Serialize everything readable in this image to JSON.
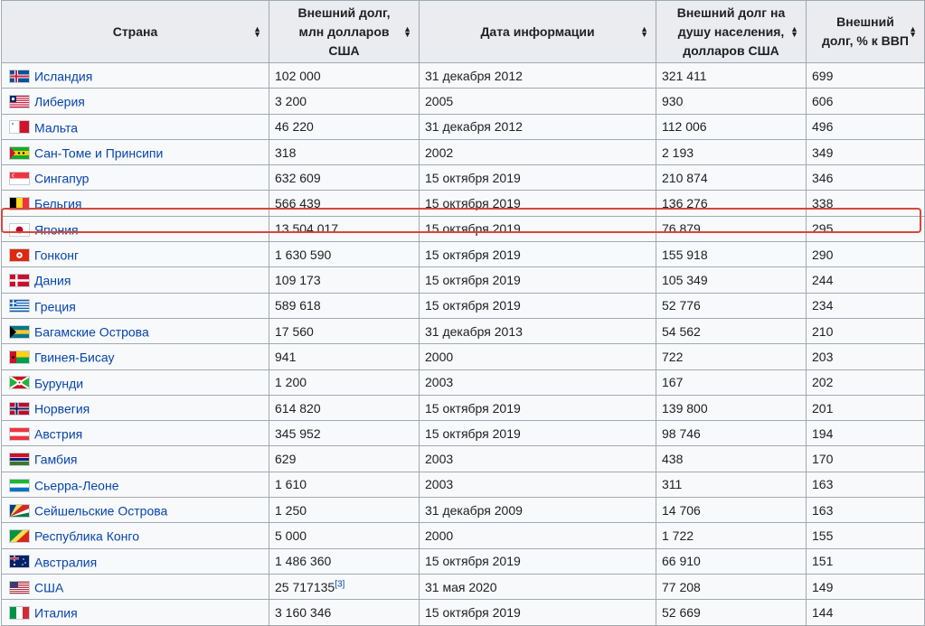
{
  "headers": [
    {
      "label": "Страна"
    },
    {
      "label": "Внешний долг, млн долларов США"
    },
    {
      "label": "Дата информации"
    },
    {
      "label": "Внешний долг на душу населения, долларов США"
    },
    {
      "label": "Внешний долг, % к ВВП"
    }
  ],
  "sort_icon": "sort-arrows-icon",
  "highlight_color": "#d9453c",
  "rows": [
    {
      "country": "Исландия",
      "flag": "iceland",
      "debt": "102 000",
      "date": "31 декабря 2012",
      "per_capita": "321 411",
      "gdp": "699"
    },
    {
      "country": "Либерия",
      "flag": "liberia",
      "debt": "3 200",
      "date": "2005",
      "per_capita": "930",
      "gdp": "606"
    },
    {
      "country": "Мальта",
      "flag": "malta",
      "debt": "46 220",
      "date": "31 декабря 2012",
      "per_capita": "112 006",
      "gdp": "496"
    },
    {
      "country": "Сан-Томе и Принсипи",
      "flag": "sao-tome",
      "debt": "318",
      "date": "2002",
      "per_capita": "2 193",
      "gdp": "349"
    },
    {
      "country": "Сингапур",
      "flag": "singapore",
      "debt": "632 609",
      "date": "15 октября 2019",
      "per_capita": "210 874",
      "gdp": "346"
    },
    {
      "country": "Бельгия",
      "flag": "belgium",
      "debt": "566 439",
      "date": "15 октября 2019",
      "per_capita": "136 276",
      "gdp": "338"
    },
    {
      "country": "Япония",
      "flag": "japan",
      "debt": "13 504 017",
      "date": "15 октября 2019",
      "per_capita": "76 879",
      "gdp": "295"
    },
    {
      "country": "Гонконг",
      "flag": "hongkong",
      "debt": "1 630 590",
      "date": "15 октября 2019",
      "per_capita": "155 918",
      "gdp": "290"
    },
    {
      "country": "Дания",
      "flag": "denmark",
      "debt": "109 173",
      "date": "15 октября 2019",
      "per_capita": "105 349",
      "gdp": "244"
    },
    {
      "country": "Греция",
      "flag": "greece",
      "debt": "589 618",
      "date": "15 октября 2019",
      "per_capita": "52 776",
      "gdp": "234"
    },
    {
      "country": "Багамские Острова",
      "flag": "bahamas",
      "debt": "17 560",
      "date": "31 декабря 2013",
      "per_capita": "54 562",
      "gdp": "210"
    },
    {
      "country": "Гвинея-Бисау",
      "flag": "guinea-bissau",
      "debt": "941",
      "date": "2000",
      "per_capita": "722",
      "gdp": "203"
    },
    {
      "country": "Бурунди",
      "flag": "burundi",
      "debt": "1 200",
      "date": "2003",
      "per_capita": "167",
      "gdp": "202"
    },
    {
      "country": "Норвегия",
      "flag": "norway",
      "debt": "614 820",
      "date": "15 октября 2019",
      "per_capita": "139 800",
      "gdp": "201"
    },
    {
      "country": "Австрия",
      "flag": "austria",
      "debt": "345 952",
      "date": "15 октября 2019",
      "per_capita": "98 746",
      "gdp": "194"
    },
    {
      "country": "Гамбия",
      "flag": "gambia",
      "debt": "629",
      "date": "2003",
      "per_capita": "438",
      "gdp": "170"
    },
    {
      "country": "Сьерра-Леоне",
      "flag": "sierra-leone",
      "debt": "1 610",
      "date": "2003",
      "per_capita": "311",
      "gdp": "163"
    },
    {
      "country": "Сейшельские Острова",
      "flag": "seychelles",
      "debt": "1 250",
      "date": "31 декабря 2009",
      "per_capita": "14 706",
      "gdp": "163"
    },
    {
      "country": "Республика Конго",
      "flag": "congo",
      "debt": "5 000",
      "date": "2000",
      "per_capita": "1 722",
      "gdp": "155"
    },
    {
      "country": "Австралия",
      "flag": "australia",
      "debt": "1 486 360",
      "date": "15 октября 2019",
      "per_capita": "66 910",
      "gdp": "151"
    },
    {
      "country": "США",
      "flag": "usa",
      "debt": "25 717135",
      "ref": "[3]",
      "date": "31 мая 2020",
      "per_capita": "77 208",
      "gdp": "149"
    },
    {
      "country": "Италия",
      "flag": "italy",
      "debt": "3 160 346",
      "date": "15 октября 2019",
      "per_capita": "52 669",
      "gdp": "144"
    }
  ]
}
